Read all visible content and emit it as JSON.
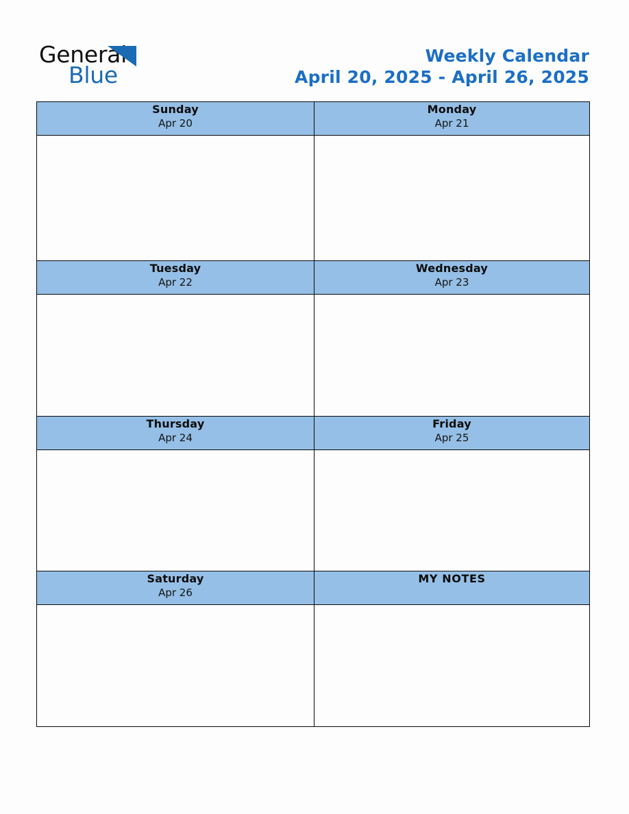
{
  "logo": {
    "word_top": "General",
    "word_bottom": "Blue",
    "triangle_icon": "triangle-icon",
    "brand_blue": "#1a6ab4"
  },
  "header": {
    "title": "Weekly Calendar",
    "date_range": "April 20, 2025 - April 26, 2025",
    "title_color": "#1b6fc4"
  },
  "theme": {
    "header_cell_bg": "#95bfe6",
    "body_cell_bg": "#fdfdfd",
    "border_color": "#0a0a0a",
    "page_bg": "#fdfdfd"
  },
  "calendar": {
    "cells": [
      {
        "name": "Sunday",
        "date": "Apr 20",
        "note": ""
      },
      {
        "name": "Monday",
        "date": "Apr 21",
        "note": ""
      },
      {
        "name": "Tuesday",
        "date": "Apr 22",
        "note": ""
      },
      {
        "name": "Wednesday",
        "date": "Apr 23",
        "note": ""
      },
      {
        "name": "Thursday",
        "date": "Apr 24",
        "note": ""
      },
      {
        "name": "Friday",
        "date": "Apr 25",
        "note": ""
      },
      {
        "name": "Saturday",
        "date": "Apr 26",
        "note": ""
      },
      {
        "name": "MY NOTES",
        "date": "",
        "note": ""
      }
    ]
  }
}
